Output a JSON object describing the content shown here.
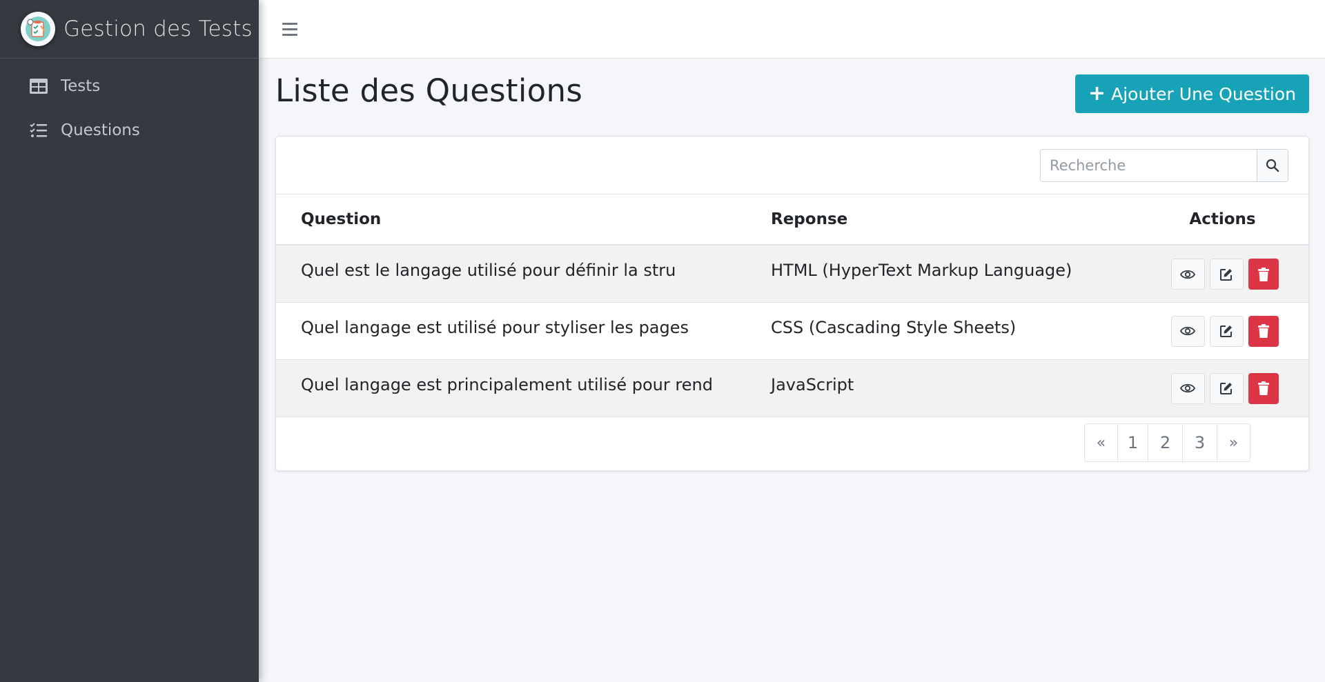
{
  "brand": {
    "title": "Gestion des Tests",
    "logo_icon": "clipboard-logo-icon"
  },
  "sidebar": {
    "items": [
      {
        "label": "Tests",
        "icon": "table-icon"
      },
      {
        "label": "Questions",
        "icon": "tasks-list-icon"
      }
    ]
  },
  "header": {
    "menu_icon": "hamburger-menu-icon"
  },
  "main": {
    "title": "Liste des Questions",
    "add_button_label": "Ajouter Une Question",
    "search": {
      "placeholder": "Recherche",
      "value": ""
    },
    "table": {
      "columns": [
        "Question",
        "Reponse",
        "Actions"
      ],
      "rows": [
        {
          "question": "Quel est le langage utilisé pour définir la stru",
          "reponse": "HTML (HyperText Markup Language)"
        },
        {
          "question": "Quel langage est utilisé pour styliser les pages",
          "reponse": "CSS (Cascading Style Sheets)"
        },
        {
          "question": "Quel langage est principalement utilisé pour rend",
          "reponse": "JavaScript"
        }
      ]
    },
    "pagination": {
      "prev": "«",
      "pages": [
        "1",
        "2",
        "3"
      ],
      "next": "»"
    }
  },
  "colors": {
    "sidebar_bg": "#343a40",
    "accent": "#17a2b8",
    "danger": "#dc3545",
    "content_bg": "#f4f6f9"
  }
}
